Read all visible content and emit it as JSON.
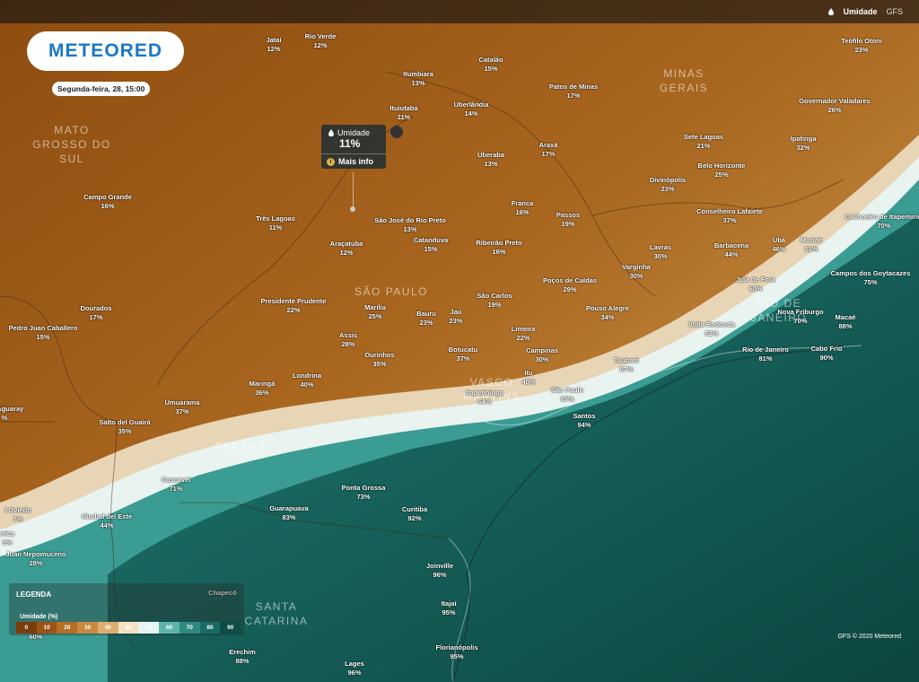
{
  "topbar": {
    "layer_label": "Umidade",
    "model_label": "GFS"
  },
  "logo": {
    "text": "METEORED"
  },
  "date_label": "Segunda-feira, 28, 15:00",
  "tooltip": {
    "title": "Umidade",
    "value": "11%",
    "more_label": "Mais info"
  },
  "regions": [
    {
      "name": "MATO\nGROSSO DO\nSUL"
    },
    {
      "name": "MINAS\nGERAIS"
    },
    {
      "name": "SÃO PAULO"
    },
    {
      "name": "RIO DE\nJANEIRO"
    },
    {
      "name": "PARANÁ"
    },
    {
      "name": "SANTA\nCATARINA"
    },
    {
      "name": "VASCO\nMARTINS"
    }
  ],
  "cities": [
    {
      "name": "Jataí",
      "value": "12%"
    },
    {
      "name": "Rio Verde",
      "value": "12%"
    },
    {
      "name": "Catalão",
      "value": "15%"
    },
    {
      "name": "Teófilo Otoni",
      "value": "23%"
    },
    {
      "name": "Itumbiara",
      "value": "13%"
    },
    {
      "name": "Patos de Minas",
      "value": "17%"
    },
    {
      "name": "Ituiutaba",
      "value": "11%"
    },
    {
      "name": "Uberlândia",
      "value": "14%"
    },
    {
      "name": "Governador Valadares",
      "value": "26%"
    },
    {
      "name": "Araxá",
      "value": "17%"
    },
    {
      "name": "Sete Lagoas",
      "value": "21%"
    },
    {
      "name": "Ipatinga",
      "value": "32%"
    },
    {
      "name": "Uberaba",
      "value": "13%"
    },
    {
      "name": "Belo Horizonte",
      "value": "25%"
    },
    {
      "name": "Campo Grande",
      "value": "16%"
    },
    {
      "name": "Divinópolis",
      "value": "23%"
    },
    {
      "name": "Franca",
      "value": "16%"
    },
    {
      "name": "Passos",
      "value": "19%"
    },
    {
      "name": "Conselheiro Lafaiete",
      "value": "37%"
    },
    {
      "name": "Cachoeiro de Itapemirim",
      "value": "70%"
    },
    {
      "name": "Três Lagoas",
      "value": "11%"
    },
    {
      "name": "São José do Rio Preto",
      "value": "13%"
    },
    {
      "name": "Catanduva",
      "value": "15%"
    },
    {
      "name": "Ribeirão Preto",
      "value": "16%"
    },
    {
      "name": "Araçatuba",
      "value": "12%"
    },
    {
      "name": "Ubá",
      "value": "46%"
    },
    {
      "name": "Muriaé",
      "value": "51%"
    },
    {
      "name": "Lavras",
      "value": "30%"
    },
    {
      "name": "Barbacena",
      "value": "44%"
    },
    {
      "name": "Varginha",
      "value": "30%"
    },
    {
      "name": "Campos dos Goytacazes",
      "value": "75%"
    },
    {
      "name": "Juiz de Fora",
      "value": "60%"
    },
    {
      "name": "Poços de Caldas",
      "value": "29%"
    },
    {
      "name": "Presidente Prudente",
      "value": "22%"
    },
    {
      "name": "São Carlos",
      "value": "19%"
    },
    {
      "name": "Dourados",
      "value": "17%"
    },
    {
      "name": "Marília",
      "value": "25%"
    },
    {
      "name": "Bauru",
      "value": "23%"
    },
    {
      "name": "Jaú",
      "value": "23%"
    },
    {
      "name": "Pouso Alegre",
      "value": "34%"
    },
    {
      "name": "Nova Friburgo",
      "value": "70%"
    },
    {
      "name": "Macaé",
      "value": "88%"
    },
    {
      "name": "Pedro Juan Caballero",
      "value": "15%"
    },
    {
      "name": "Limeira",
      "value": "22%"
    },
    {
      "name": "Volta Redonda",
      "value": "52%"
    },
    {
      "name": "Assis",
      "value": "28%"
    },
    {
      "name": "Campinas",
      "value": "30%"
    },
    {
      "name": "Ourinhos",
      "value": "35%"
    },
    {
      "name": "Botucatu",
      "value": "37%"
    },
    {
      "name": "Rio de Janeiro",
      "value": "81%"
    },
    {
      "name": "Cabo Frio",
      "value": "90%"
    },
    {
      "name": "Taubaté",
      "value": "57%"
    },
    {
      "name": "Londrina",
      "value": "40%"
    },
    {
      "name": "Itu",
      "value": "40%"
    },
    {
      "name": "Maringá",
      "value": "36%"
    },
    {
      "name": "São Paulo",
      "value": "85%"
    },
    {
      "name": "Itapetininga",
      "value": "64%"
    },
    {
      "name": "del Aguaray",
      "value": "%"
    },
    {
      "name": "Umuarama",
      "value": "37%"
    },
    {
      "name": "Santos",
      "value": "94%"
    },
    {
      "name": "Salto del Guairá",
      "value": "35%"
    },
    {
      "name": "Cascavel",
      "value": "71%"
    },
    {
      "name": "Ponta Grossa",
      "value": "73%"
    },
    {
      "name": "Guarapuava",
      "value": "83%"
    },
    {
      "name": "Curitiba",
      "value": "92%"
    },
    {
      "name": "l Oviedo",
      "value": "7%"
    },
    {
      "name": "Ciudad del Este",
      "value": "44%"
    },
    {
      "name": "rrica",
      "value": "9%"
    },
    {
      "name": "Juan Nepomuceno",
      "value": "28%"
    },
    {
      "name": "Joinville",
      "value": "96%"
    },
    {
      "name": "Chapecó",
      "value": ""
    },
    {
      "name": "Itajaí",
      "value": "95%"
    },
    {
      "name": "Florianópolis",
      "value": "95%"
    },
    {
      "name": "Erechim",
      "value": "88%"
    },
    {
      "name": "Lages",
      "value": "96%"
    },
    {
      "name": "",
      "value": "60%"
    }
  ],
  "legend": {
    "title": "LEGENDA",
    "subtitle": "Umidade (%)",
    "ticks": [
      "0",
      "10",
      "20",
      "30",
      "40",
      "45",
      "55",
      "60",
      "70",
      "80",
      "90"
    ],
    "colors": [
      "#7a3d0a",
      "#9a5515",
      "#b46e25",
      "#c98a40",
      "#dcae70",
      "#f1e1c2",
      "#e7f5f2",
      "#5cb5aa",
      "#2f8a82",
      "#1a6b63",
      "#0f4d47"
    ]
  },
  "copyright": "GFS © 2020 Meteored"
}
